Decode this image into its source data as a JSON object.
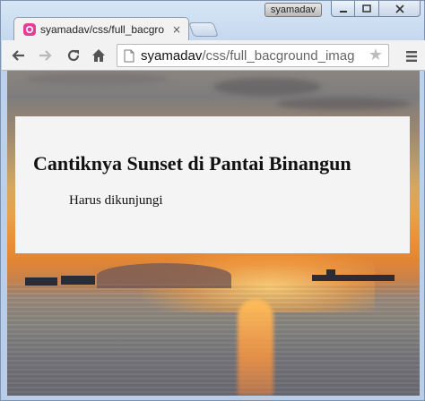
{
  "window": {
    "user_name": "syamadav"
  },
  "tabs": [
    {
      "title": "syamadav/css/full_bacgro",
      "close_glyph": "×",
      "favicon": "page-favicon-icon"
    }
  ],
  "toolbar": {
    "url_host": "syamadav",
    "url_path": "/css/full_bacground_imag",
    "star_glyph": "★",
    "icons": [
      "back-arrow-icon",
      "forward-arrow-icon",
      "reload-icon",
      "home-icon",
      "page-icon",
      "star-icon",
      "menu-icon"
    ]
  },
  "page": {
    "heading": "Cantiknya Sunset di Pantai Binangun",
    "subtext": "Harus dikunjungi"
  },
  "colors": {
    "favicon": "#e0409a",
    "overlay_bg": "#f4f4f4",
    "sunset_orange": "#e9913a"
  }
}
